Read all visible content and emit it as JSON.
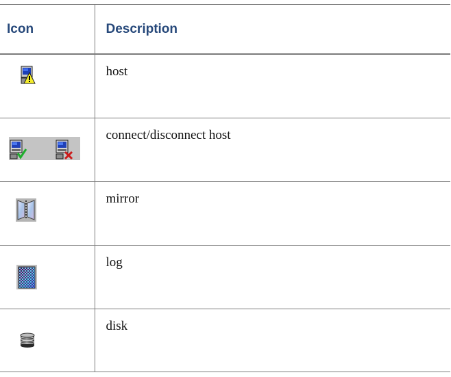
{
  "table": {
    "headers": {
      "icon": "Icon",
      "description": "Description"
    },
    "rows": [
      {
        "icon": "host-icon",
        "description": "host"
      },
      {
        "icon": "connect-disconnect-host-icon",
        "description": "connect/disconnect host"
      },
      {
        "icon": "mirror-icon",
        "description": "mirror"
      },
      {
        "icon": "log-icon",
        "description": "log"
      },
      {
        "icon": "disk-icon",
        "description": "disk"
      }
    ]
  },
  "colors": {
    "header_text": "#26487a",
    "body_text": "#111111",
    "border": "#7a7a7a"
  }
}
